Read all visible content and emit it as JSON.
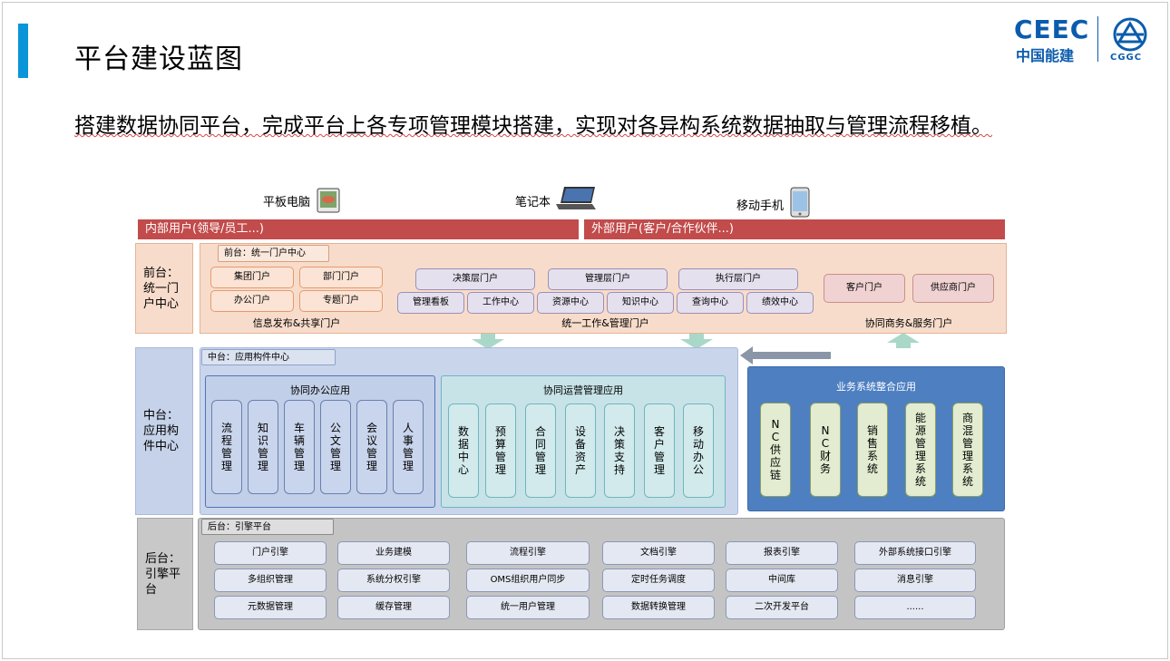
{
  "title": "平台建设蓝图",
  "logo": {
    "brand": "CEEC",
    "brand_cn": "中国能建",
    "mark_text": "CGGC"
  },
  "subtitle": "搭建数据协同平台，完成平台上各专项管理模块搭建，实现对各异构系统数据抽取与管理流程移植。",
  "devices": {
    "tablet": "平板电脑",
    "laptop": "笔记本",
    "phone": "移动手机"
  },
  "user_bars": {
    "internal": "内部用户(领导/员工...)",
    "external": "外部用户(客户/合作伙伴...)"
  },
  "front": {
    "label": [
      "前台：",
      "统一门",
      "户中心"
    ],
    "tag": "前台：统一门户中心",
    "left_pills": [
      "集团门户",
      "部门门户",
      "办公门户",
      "专题门户"
    ],
    "left_caption": "信息发布&共享门户",
    "center_top": [
      "决策层门户",
      "管理层门户",
      "执行层门户"
    ],
    "center_bottom": [
      "管理看板",
      "工作中心",
      "资源中心",
      "知识中心",
      "查询中心",
      "绩效中心"
    ],
    "center_caption": "统一工作&管理门户",
    "right_pills": [
      "客户门户",
      "供应商门户"
    ],
    "right_caption": "协同商务&服务门户"
  },
  "middle": {
    "label": [
      "中台：",
      "应用构",
      "件中心"
    ],
    "tag": "中台：应用构件中心",
    "office": {
      "title": "协同办公应用",
      "items": [
        "流程管理",
        "知识管理",
        "车辆管理",
        "公文管理",
        "会议管理",
        "人事管理"
      ]
    },
    "ops": {
      "title": "协同运营管理应用",
      "items": [
        "数据中心",
        "预算管理",
        "合同管理",
        "设备资产",
        "决策支持",
        "客户管理",
        "移动办公"
      ]
    },
    "biz": {
      "title": "业务系统整合应用",
      "items": [
        "NC供应链",
        "NC财务",
        "销售系统",
        "能源管理系统",
        "商混管理系统"
      ]
    }
  },
  "back": {
    "label": [
      "后台：",
      "引擎平",
      "台"
    ],
    "tag": "后台：引擎平台",
    "grid": [
      [
        "门户引擎",
        "业务建模",
        "流程引擎",
        "文档引擎",
        "报表引擎",
        "外部系统接口引擎"
      ],
      [
        "多组织管理",
        "系统分权引擎",
        "OMS组织用户同步",
        "定时任务调度",
        "中间库",
        "消息引擎"
      ],
      [
        "元数据管理",
        "缓存管理",
        "统一用户管理",
        "数据转换管理",
        "二次开发平台",
        "......"
      ]
    ]
  },
  "colors": {
    "accent": "#0a95d9",
    "user_bar": "#c24b4b",
    "front_bg": "#f8dccb",
    "middle_bg": "#c9d5eb",
    "back_bg": "#c4c4c4",
    "biz_bg": "#4d7fc1",
    "arrow": "#a9d8c8"
  }
}
